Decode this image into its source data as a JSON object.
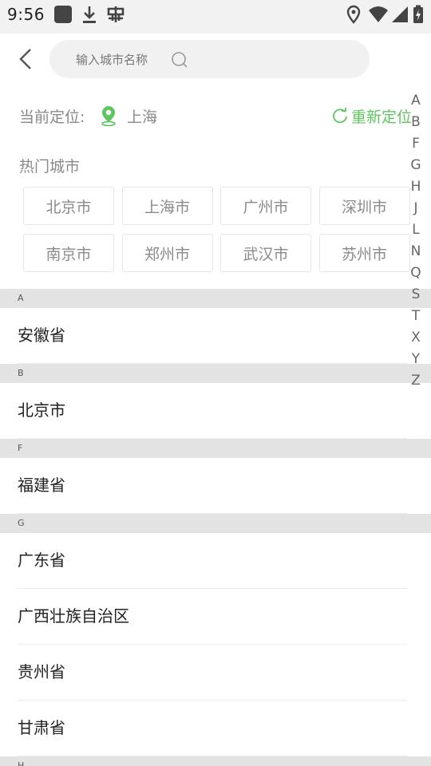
{
  "status_bar": {
    "time": "9:56",
    "icons": [
      "app-square-icon",
      "download-icon",
      "bug-icon",
      "location-icon",
      "wifi-icon",
      "signal-icon",
      "battery-charging-icon"
    ]
  },
  "search": {
    "placeholder": "输入城市名称"
  },
  "current_location": {
    "label": "当前定位:",
    "city": "上海",
    "relocate_label": "重新定位",
    "accent_color": "#5fc65f"
  },
  "hot_cities": {
    "title": "热门城市",
    "items": [
      "北京市",
      "上海市",
      "广州市",
      "深圳市",
      "南京市",
      "郑州市",
      "武汉市",
      "苏州市"
    ]
  },
  "sections": [
    {
      "letter": "A",
      "items": [
        "安徽省"
      ]
    },
    {
      "letter": "B",
      "items": [
        "北京市"
      ]
    },
    {
      "letter": "F",
      "items": [
        "福建省"
      ]
    },
    {
      "letter": "G",
      "items": [
        "广东省",
        "广西壮族自治区",
        "贵州省",
        "甘肃省"
      ]
    },
    {
      "letter": "H",
      "items": []
    }
  ],
  "index_letters": [
    "A",
    "B",
    "F",
    "G",
    "H",
    "J",
    "L",
    "N",
    "Q",
    "S",
    "T",
    "X",
    "Y",
    "Z"
  ]
}
